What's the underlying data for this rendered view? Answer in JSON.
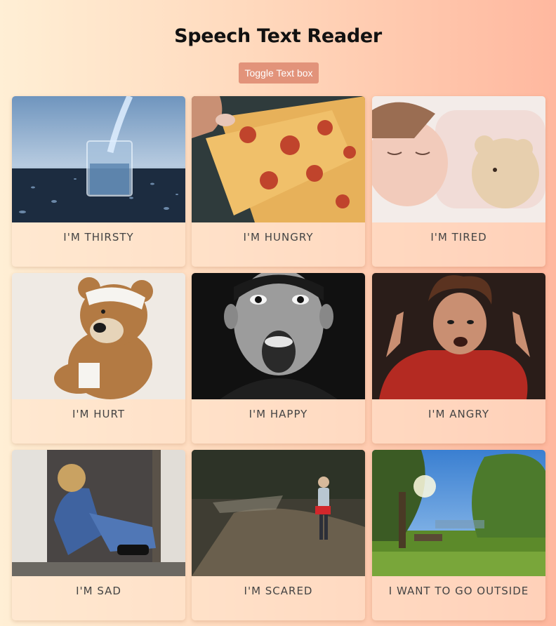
{
  "header": {
    "title": "Speech Text Reader",
    "toggle_label": "Toggle Text box"
  },
  "cards": [
    {
      "label": "I'M THIRSTY",
      "image": "glass-of-water",
      "action": "speak"
    },
    {
      "label": "I'M HUNGRY",
      "image": "pizza",
      "action": "speak"
    },
    {
      "label": "I'M TIRED",
      "image": "sleeping-child",
      "action": "speak"
    },
    {
      "label": "I'M HURT",
      "image": "bandaged-teddy-bear",
      "action": "speak"
    },
    {
      "label": "I'M HAPPY",
      "image": "excited-boy",
      "action": "speak"
    },
    {
      "label": "I'M ANGRY",
      "image": "angry-child",
      "action": "speak"
    },
    {
      "label": "I'M SAD",
      "image": "sad-girl",
      "action": "speak"
    },
    {
      "label": "I'M SCARED",
      "image": "scared-girl-in-woods",
      "action": "speak"
    },
    {
      "label": "I WANT TO GO OUTSIDE",
      "image": "sunny-park",
      "action": "speak"
    }
  ],
  "colors": {
    "toggle_button": "#e2937a",
    "background_start": "#ffefd5",
    "background_end": "#ffb89f",
    "card_label": "#444444"
  }
}
